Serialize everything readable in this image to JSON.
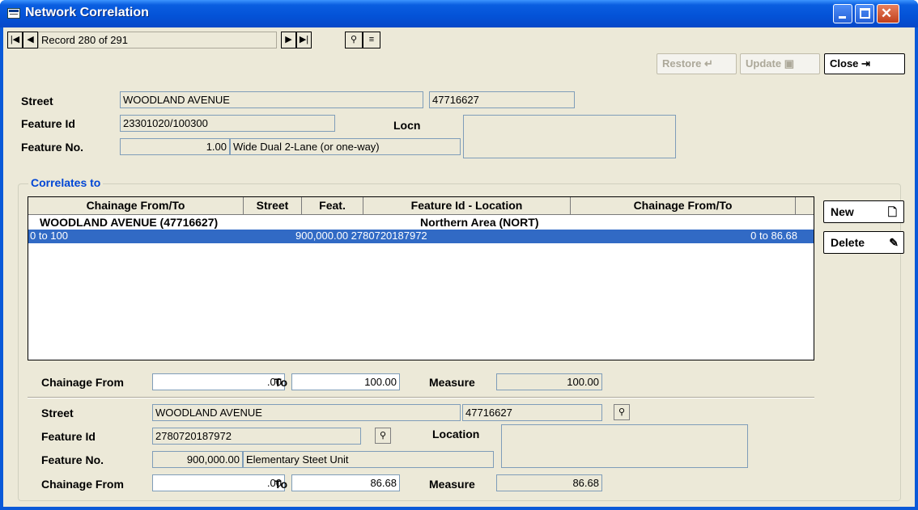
{
  "window": {
    "title": "Network Correlation"
  },
  "nav": {
    "record_text": "Record 280 of 291"
  },
  "toolbar": {
    "restore_label": "Restore",
    "update_label": "Update",
    "close_label": "Close"
  },
  "header": {
    "street_label": "Street",
    "street_value": "WOODLAND AVENUE",
    "street_code": "47716627",
    "feature_id_label": "Feature Id",
    "feature_id_value": "23301020/100300",
    "locn_label": "Locn",
    "locn_value": "",
    "feature_no_label": "Feature No.",
    "feature_no_value": "1.00",
    "feature_desc": "Wide Dual 2-Lane (or one-way)"
  },
  "correlates": {
    "title": "Correlates to",
    "columns": [
      "Chainage From/To",
      "Street",
      "Feat.",
      "Feature Id - Location",
      "Chainage From/To"
    ],
    "group_row": {
      "street": "WOODLAND AVENUE (47716627)",
      "area": "Northern Area (NORT)"
    },
    "selected_row": {
      "chainage": "0 to 100",
      "feat_id": "900,000.00 2780720187972",
      "chainage_to": "0 to 86.68"
    },
    "new_label": "New",
    "delete_label": "Delete"
  },
  "chainage1": {
    "from_label": "Chainage From",
    "from_value": ".00",
    "to_label": "To",
    "to_value": "100.00",
    "measure_label": "Measure",
    "measure_value": "100.00"
  },
  "detail": {
    "street_label": "Street",
    "street_value": "WOODLAND AVENUE",
    "street_code": "47716627",
    "feature_id_label": "Feature Id",
    "feature_id_value": "2780720187972",
    "location_label": "Location",
    "location_value": "",
    "feature_no_label": "Feature No.",
    "feature_no_value": "900,000.00",
    "feature_desc": "Elementary Steet Unit"
  },
  "chainage2": {
    "from_label": "Chainage From",
    "from_value": ".00",
    "to_label": "To",
    "to_value": "86.68",
    "measure_label": "Measure",
    "measure_value": "86.68"
  }
}
